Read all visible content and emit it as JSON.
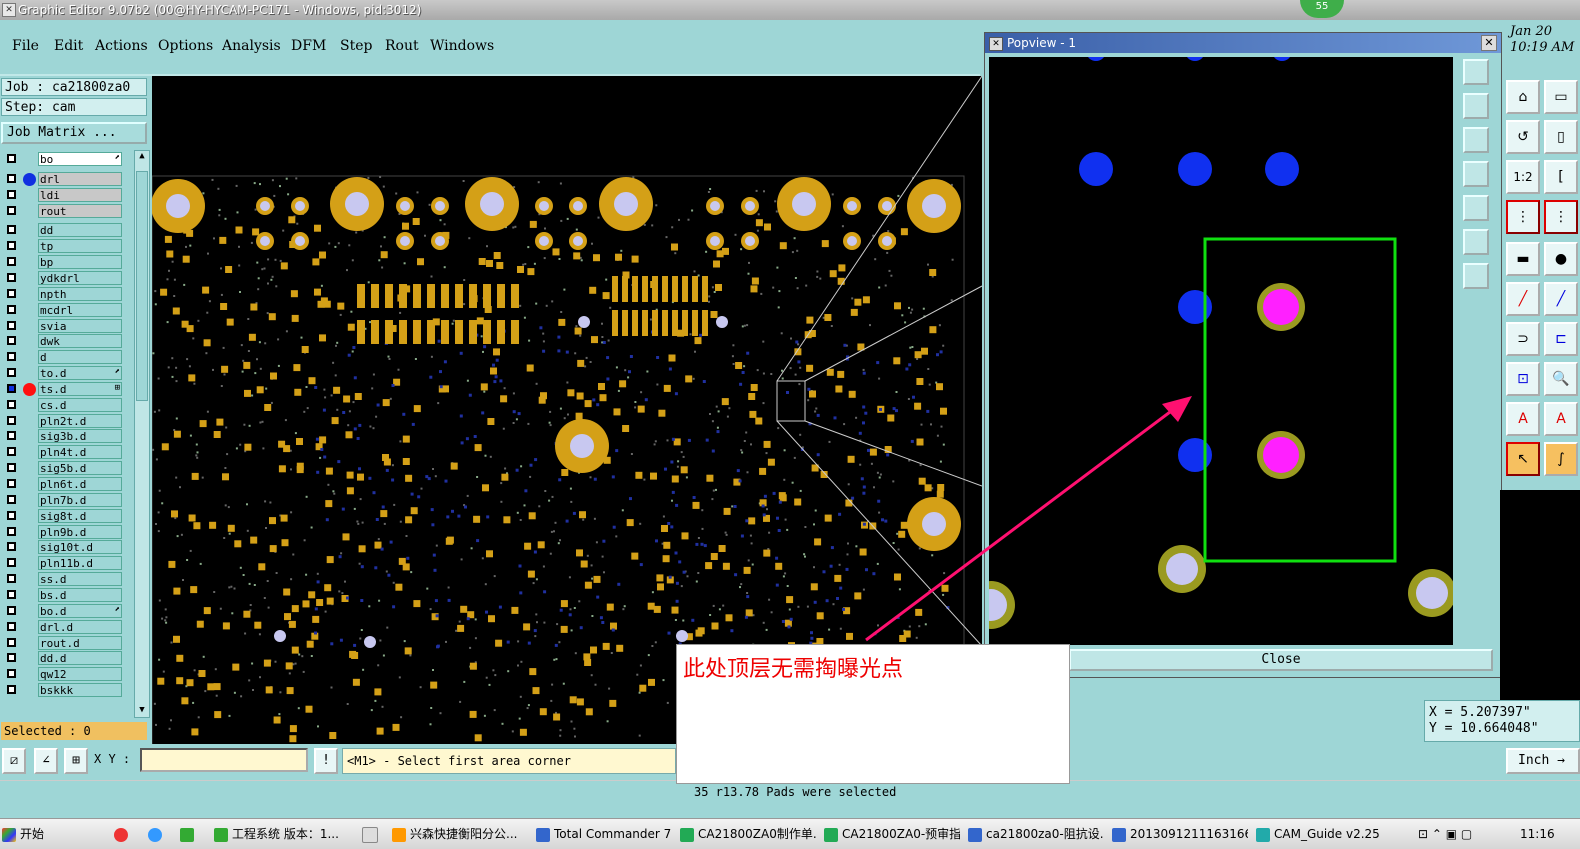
{
  "window": {
    "title": "Graphic Editor 9.07b2 (00@HY-HYCAM-PC171 - Windows, pid:3012)",
    "badge": "55",
    "clock_date": "Jan 20",
    "clock_time": "10:19 AM"
  },
  "menu": [
    "File",
    "Edit",
    "Actions",
    "Options",
    "Analysis",
    "DFM",
    "Step",
    "Rout",
    "Windows"
  ],
  "job": {
    "job_label": "Job : ca21800za0",
    "step_label": "Step: cam",
    "matrix_button": "Job Matrix ...",
    "selected": "Selected : 0"
  },
  "layers": [
    {
      "name": "bo",
      "dot": "",
      "style": "white",
      "mark": "⬈"
    },
    {
      "name": "drl",
      "dot": "#1030e0",
      "style": "sel",
      "mark": ""
    },
    {
      "name": "ldi",
      "dot": "",
      "style": "sel",
      "mark": ""
    },
    {
      "name": "rout",
      "dot": "",
      "style": "sel",
      "mark": ""
    },
    {
      "name": "dd",
      "dot": "",
      "style": "",
      "mark": ""
    },
    {
      "name": "tp",
      "dot": "",
      "style": "",
      "mark": ""
    },
    {
      "name": "bp",
      "dot": "",
      "style": "",
      "mark": ""
    },
    {
      "name": "ydkdrl",
      "dot": "",
      "style": "",
      "mark": ""
    },
    {
      "name": "npth",
      "dot": "",
      "style": "",
      "mark": ""
    },
    {
      "name": "mcdrl",
      "dot": "",
      "style": "",
      "mark": ""
    },
    {
      "name": "svia",
      "dot": "",
      "style": "",
      "mark": ""
    },
    {
      "name": "dwk",
      "dot": "",
      "style": "",
      "mark": ""
    },
    {
      "name": "d",
      "dot": "",
      "style": "",
      "mark": ""
    },
    {
      "name": "to.d",
      "dot": "",
      "style": "",
      "mark": "⬈"
    },
    {
      "name": "ts.d",
      "dot": "#ff1010",
      "style": "",
      "mark": "⊞"
    },
    {
      "name": "cs.d",
      "dot": "",
      "style": "",
      "mark": ""
    },
    {
      "name": "pln2t.d",
      "dot": "",
      "style": "",
      "mark": ""
    },
    {
      "name": "sig3b.d",
      "dot": "",
      "style": "",
      "mark": ""
    },
    {
      "name": "pln4t.d",
      "dot": "",
      "style": "",
      "mark": ""
    },
    {
      "name": "sig5b.d",
      "dot": "",
      "style": "",
      "mark": ""
    },
    {
      "name": "pln6t.d",
      "dot": "",
      "style": "",
      "mark": ""
    },
    {
      "name": "pln7b.d",
      "dot": "",
      "style": "",
      "mark": ""
    },
    {
      "name": "sig8t.d",
      "dot": "",
      "style": "",
      "mark": ""
    },
    {
      "name": "pln9b.d",
      "dot": "",
      "style": "",
      "mark": ""
    },
    {
      "name": "sig10t.d",
      "dot": "",
      "style": "",
      "mark": ""
    },
    {
      "name": "pln11b.d",
      "dot": "",
      "style": "",
      "mark": ""
    },
    {
      "name": "ss.d",
      "dot": "",
      "style": "",
      "mark": ""
    },
    {
      "name": "bs.d",
      "dot": "",
      "style": "",
      "mark": ""
    },
    {
      "name": "bo.d",
      "dot": "",
      "style": "",
      "mark": "⬈"
    },
    {
      "name": "drl.d",
      "dot": "",
      "style": "",
      "mark": ""
    },
    {
      "name": "rout.d",
      "dot": "",
      "style": "",
      "mark": ""
    },
    {
      "name": "dd.d",
      "dot": "",
      "style": "",
      "mark": ""
    },
    {
      "name": "qw12",
      "dot": "",
      "style": "",
      "mark": ""
    },
    {
      "name": "bskkk",
      "dot": "",
      "style": "",
      "mark": ""
    }
  ],
  "popview": {
    "title": "Popview - 1",
    "close_label": "Close"
  },
  "coords": {
    "x": "X = 5.207397\"",
    "y": "Y = 10.664048\""
  },
  "cmd": {
    "xy_label": "X Y :",
    "xy_value": "",
    "message": "<M1> - Select first area corner",
    "units": "Inch"
  },
  "status": "35 r13.78 Pads were selected",
  "annotation": "此处顶层无需掏曝光点",
  "taskbar": {
    "start": "开始",
    "items": [
      "工程系统 版本：1...",
      "兴森快捷衡阳分公...",
      "Total Commander 7.0...",
      "CA21800ZA0制作单....",
      "CA21800ZA0-预审指...",
      "ca21800za0-阻抗设...",
      "20130912111631664...",
      "CAM_Guide v2.25"
    ],
    "time": "11:16"
  },
  "colors": {
    "pad": "#d4a017",
    "hole": "#c8c8f0",
    "drill": "#1030f0",
    "selected_pad": "#ff20ff",
    "selection_box": "#10e010",
    "arrow": "#ff1070"
  }
}
